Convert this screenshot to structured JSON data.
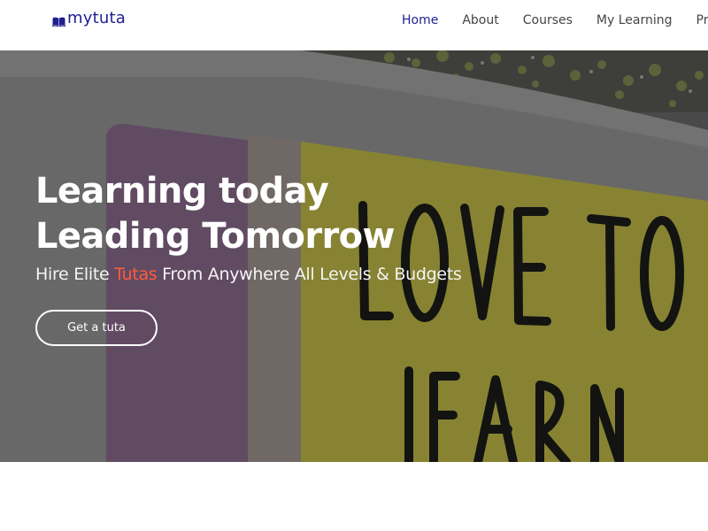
{
  "header": {
    "logo_text": "mytuta",
    "logo_icon": "open-book-icon",
    "nav": [
      {
        "label": "Home",
        "active": true
      },
      {
        "label": "About",
        "active": false
      },
      {
        "label": "Courses",
        "active": false
      },
      {
        "label": "My Learning",
        "active": false
      },
      {
        "label": "Pri",
        "active": false
      }
    ]
  },
  "hero": {
    "title_line1": "Learning today",
    "title_line2": "Leading Tomorrow",
    "subtitle_before": "Hire Elite ",
    "subtitle_accent": "Tutas",
    "subtitle_after": " From Anywhere All Levels & Budgets",
    "cta_label": "Get a tuta",
    "background_sign_text": [
      "LOVE TO",
      "LEARN"
    ]
  },
  "colors": {
    "brand": "#1f1f8f",
    "accent": "#ff5b3a",
    "nav_text": "#444444"
  }
}
